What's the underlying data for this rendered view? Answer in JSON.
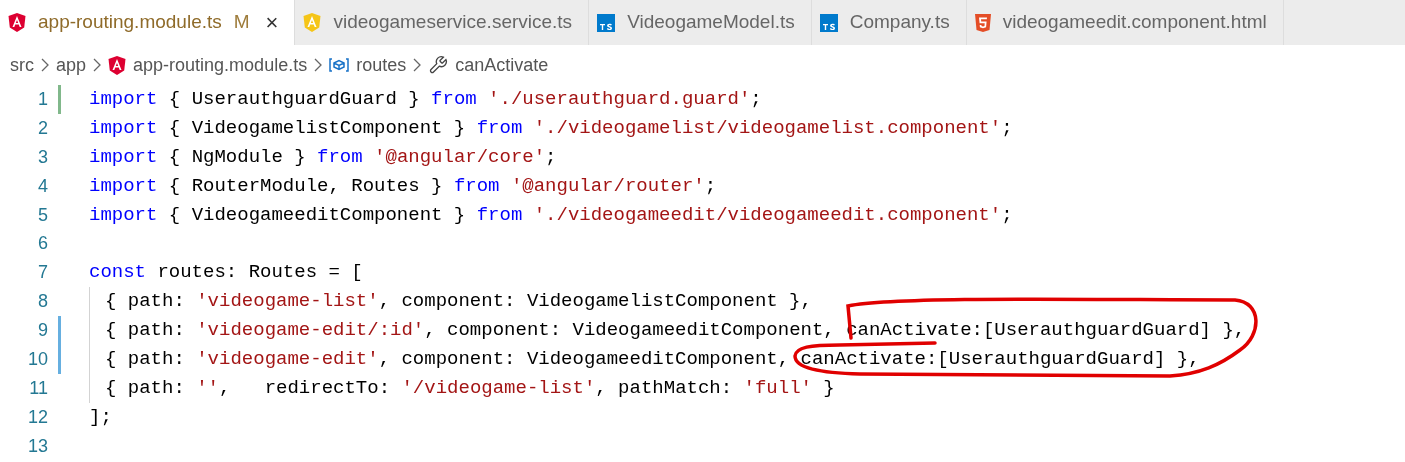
{
  "tabs": [
    {
      "label": "app-routing.module.ts",
      "kind": "angular",
      "selected": true,
      "modified_flag": "M",
      "close": "×"
    },
    {
      "label": "videogameservice.service.ts",
      "kind": "angular-service",
      "selected": false
    },
    {
      "label": "VideogameModel.ts",
      "kind": "typescript",
      "selected": false
    },
    {
      "label": "Company.ts",
      "kind": "typescript",
      "selected": false
    },
    {
      "label": "videogameedit.component.html",
      "kind": "html",
      "selected": false
    }
  ],
  "breadcrumb": [
    {
      "label": "src",
      "kind": "folder"
    },
    {
      "label": "app",
      "kind": "folder"
    },
    {
      "label": "app-routing.module.ts",
      "kind": "angular"
    },
    {
      "label": "routes",
      "kind": "variable"
    },
    {
      "label": "canActivate",
      "kind": "property"
    }
  ],
  "editor": {
    "lines": [
      {
        "number": "1",
        "added": true,
        "modified": false,
        "guide": false,
        "tokens": [
          {
            "kind": "keyword",
            "text": "import"
          },
          {
            "kind": "plain",
            "text": " { UserauthguardGuard } "
          },
          {
            "kind": "keyword",
            "text": "from"
          },
          {
            "kind": "string",
            "text": " './userauthguard.guard'"
          },
          {
            "kind": "plain",
            "text": ";"
          }
        ]
      },
      {
        "number": "2",
        "added": false,
        "modified": false,
        "guide": false,
        "tokens": [
          {
            "kind": "keyword",
            "text": "import"
          },
          {
            "kind": "plain",
            "text": " { VideogamelistComponent } "
          },
          {
            "kind": "keyword",
            "text": "from"
          },
          {
            "kind": "string",
            "text": " './videogamelist/videogamelist.component'"
          },
          {
            "kind": "plain",
            "text": ";"
          }
        ]
      },
      {
        "number": "3",
        "added": false,
        "modified": false,
        "guide": false,
        "tokens": [
          {
            "kind": "keyword",
            "text": "import"
          },
          {
            "kind": "plain",
            "text": " { NgModule } "
          },
          {
            "kind": "keyword",
            "text": "from"
          },
          {
            "kind": "string",
            "text": " '@angular/core'"
          },
          {
            "kind": "plain",
            "text": ";"
          }
        ]
      },
      {
        "number": "4",
        "added": false,
        "modified": false,
        "guide": false,
        "tokens": [
          {
            "kind": "keyword",
            "text": "import"
          },
          {
            "kind": "plain",
            "text": " { RouterModule, Routes } "
          },
          {
            "kind": "keyword",
            "text": "from"
          },
          {
            "kind": "string",
            "text": " '@angular/router'"
          },
          {
            "kind": "plain",
            "text": ";"
          }
        ]
      },
      {
        "number": "5",
        "added": false,
        "modified": false,
        "guide": false,
        "tokens": [
          {
            "kind": "keyword",
            "text": "import"
          },
          {
            "kind": "plain",
            "text": " { VideogameeditComponent } "
          },
          {
            "kind": "keyword",
            "text": "from"
          },
          {
            "kind": "string",
            "text": " './videogameedit/videogameedit.component'"
          },
          {
            "kind": "plain",
            "text": ";"
          }
        ]
      },
      {
        "number": "6",
        "added": false,
        "modified": false,
        "guide": false
      },
      {
        "number": "7",
        "added": false,
        "modified": false,
        "guide": false,
        "tokens": [
          {
            "kind": "keyword",
            "text": "const"
          },
          {
            "kind": "plain",
            "text": " routes: Routes = ["
          }
        ]
      },
      {
        "number": "8",
        "added": false,
        "modified": false,
        "guide": true,
        "tokens": [
          {
            "kind": "plain",
            "text": "{ path: "
          },
          {
            "kind": "string",
            "text": "'videogame-list'"
          },
          {
            "kind": "plain",
            "text": ", component: VideogamelistComponent },"
          }
        ]
      },
      {
        "number": "9",
        "added": false,
        "modified": true,
        "guide": true,
        "tokens": [
          {
            "kind": "plain",
            "text": "{ path: "
          },
          {
            "kind": "string",
            "text": "'videogame-edit/:id'"
          },
          {
            "kind": "plain",
            "text": ", component: VideogameeditComponent, canActivate:[UserauthguardGuard] },"
          }
        ]
      },
      {
        "number": "10",
        "added": false,
        "modified": true,
        "guide": true,
        "tokens": [
          {
            "kind": "plain",
            "text": "{ path: "
          },
          {
            "kind": "string",
            "text": "'videogame-edit'"
          },
          {
            "kind": "plain",
            "text": ", component: VideogameeditComponent, canActivate:[UserauthguardGuard] },"
          }
        ]
      },
      {
        "number": "11",
        "added": false,
        "modified": false,
        "guide": true,
        "tokens": [
          {
            "kind": "plain",
            "text": "{ path: "
          },
          {
            "kind": "string",
            "text": "''"
          },
          {
            "kind": "plain",
            "text": ",   redirectTo: "
          },
          {
            "kind": "string",
            "text": "'/videogame-list'"
          },
          {
            "kind": "plain",
            "text": ", pathMatch: "
          },
          {
            "kind": "string",
            "text": "'full'"
          },
          {
            "kind": "plain",
            "text": " }"
          }
        ]
      },
      {
        "number": "12",
        "added": false,
        "modified": false,
        "guide": false,
        "tokens": [
          {
            "kind": "plain",
            "text": "];"
          }
        ]
      },
      {
        "number": "13",
        "added": false,
        "modified": false,
        "guide": false
      }
    ]
  }
}
